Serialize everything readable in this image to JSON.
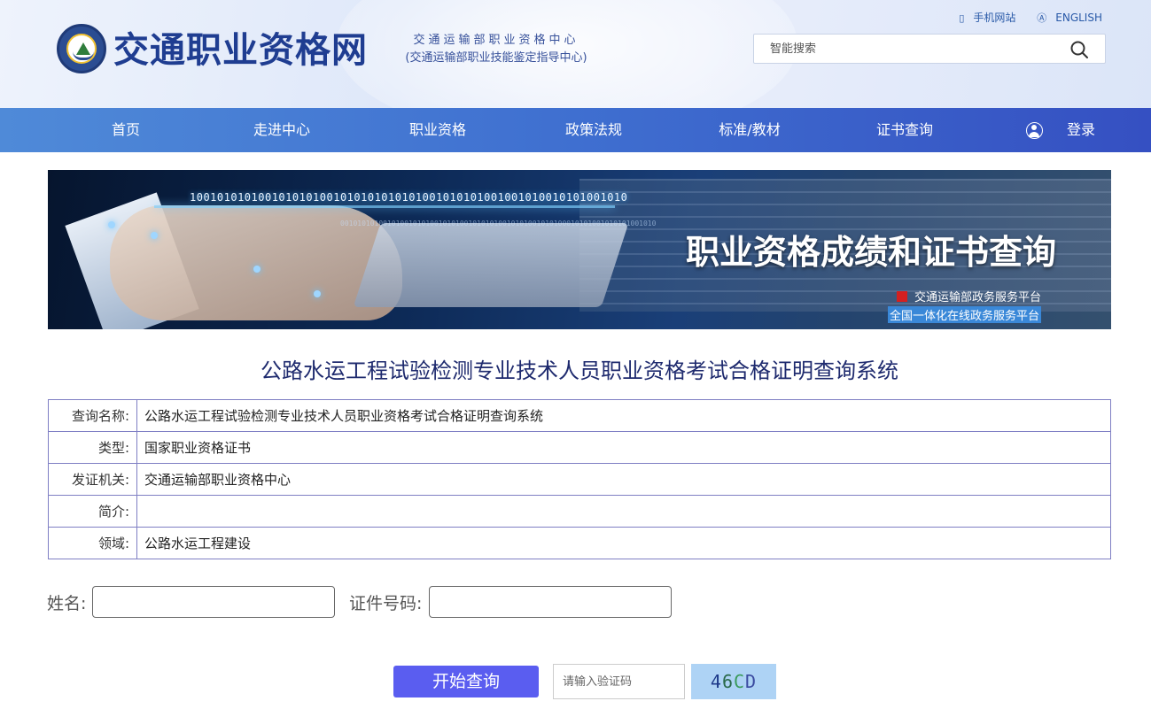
{
  "header": {
    "site_title": "交通职业资格网",
    "org_line1": "交通运输部职业资格中心",
    "org_line2": "(交通运输部职业技能鉴定指导中心)",
    "mobile_link": "手机网站",
    "english_link": "ENGLISH",
    "search_placeholder": "智能搜索"
  },
  "nav": {
    "items": [
      "首页",
      "走进中心",
      "职业资格",
      "政策法规",
      "标准/教材",
      "证书查询"
    ],
    "login_label": "登录"
  },
  "banner": {
    "title": "职业资格成绩和证书查询",
    "sub1": "交通运输部政务服务平台",
    "sub2": "全国一体化在线政务服务平台",
    "binary": "1001010101001010101001010101010101001010101001001010010101001010",
    "binary2": "00101010100101001010100101010010101010010101001010100010101001010101001010"
  },
  "system_title": "公路水运工程试验检测专业技术人员职业资格考试合格证明查询系统",
  "info": {
    "rows": [
      {
        "key": "查询名称:",
        "value": "公路水运工程试验检测专业技术人员职业资格考试合格证明查询系统"
      },
      {
        "key": "类型:",
        "value": "国家职业资格证书"
      },
      {
        "key": "发证机关:",
        "value": "交通运输部职业资格中心"
      },
      {
        "key": "简介:",
        "value": ""
      },
      {
        "key": "领域:",
        "value": "公路水运工程建设"
      }
    ]
  },
  "form": {
    "name_label": "姓名:",
    "name_value": "",
    "id_label": "证件号码:",
    "id_value": "",
    "submit_label": "开始查询",
    "captcha_placeholder": "请输入验证码",
    "captcha_chars": [
      "4",
      "6",
      "C",
      "D"
    ]
  },
  "colors": {
    "brand_blue": "#1f3d91",
    "nav_start": "#4f8ad8",
    "nav_end": "#3550c2",
    "submit_button": "#5a5df0",
    "table_border": "#7f7fc4",
    "banner_red_mark": "#d42020"
  }
}
